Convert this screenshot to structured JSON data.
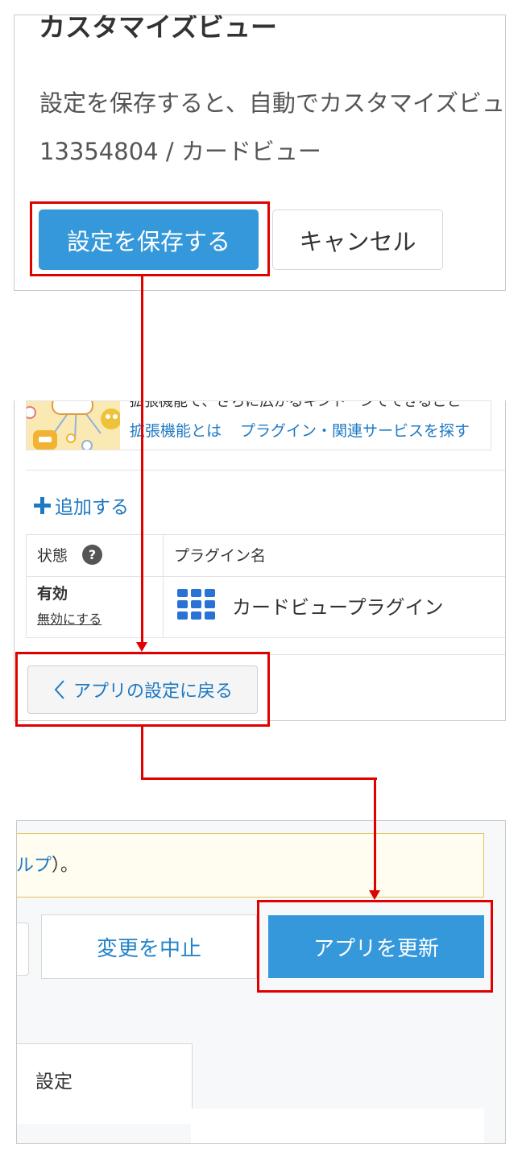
{
  "panel1": {
    "title": "カスタマイズビュー",
    "description": "設定を保存すると、自動でカスタマイズビュー",
    "view_id": "13354804 / カードビュー",
    "save_label": "設定を保存する",
    "cancel_label": "キャンセル"
  },
  "panel2": {
    "banner_text_cut": "拡張機能で、さらに広がるキントーンでできること",
    "banner_links": [
      "拡張機能とは",
      "プラグイン・関連サービスを探す"
    ],
    "add_label": "追加する",
    "table": {
      "col_status": "状態",
      "help_glyph": "?",
      "col_plugin_name": "プラグイン名",
      "status_value": "有効",
      "disable_label": "無効にする",
      "plugin_name": "カードビュープラグイン"
    },
    "back_label": "アプリの設定に戻る"
  },
  "panel3": {
    "notice_link": "ルプ",
    "notice_tail": "）。",
    "stop_label": "変更を中止",
    "update_label": "アプリを更新",
    "tab_label": "設定"
  },
  "colors": {
    "primary": "#3498db",
    "link": "#1f79c2",
    "annotation": "#e00000",
    "notice_bg": "#fffcf0",
    "notice_border": "#e5c55f"
  },
  "icons": {
    "plus": "plus-icon",
    "help": "question-circle-icon",
    "plugin": "grid-icon",
    "back": "chevron-left-icon"
  }
}
